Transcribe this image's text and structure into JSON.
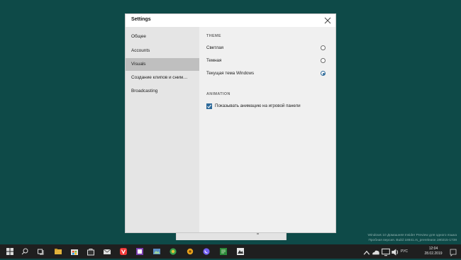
{
  "dialog": {
    "title": "Settings"
  },
  "sidebar": {
    "items": [
      {
        "label": "Общее",
        "active": false
      },
      {
        "label": "Accounts",
        "active": false
      },
      {
        "label": "Visuals",
        "active": true
      },
      {
        "label": "Создание клипов и сним…",
        "active": false
      },
      {
        "label": "Broadcasting",
        "active": false
      }
    ]
  },
  "theme": {
    "heading": "THEME",
    "options": [
      {
        "label": "Светлая",
        "selected": false
      },
      {
        "label": "Темная",
        "selected": false
      },
      {
        "label": "Текущая тема Windows",
        "selected": true
      }
    ]
  },
  "animation": {
    "heading": "ANIMATION",
    "checkbox_label": "Показывать анимацию на игровой панели",
    "checked": true
  },
  "watermark": {
    "line1": "Windows 10 Домашняя Insider Preview для одного языка",
    "line2": "Пробная версия. Build 18841.rs_prerelease.190215-1738"
  },
  "tray": {
    "language": "РУС",
    "time": "12:04",
    "date": "28.02.2019"
  },
  "colors": {
    "desktop": "#0e4a48",
    "accent": "#2e6a9a",
    "taskbar": "#1f1f1f"
  },
  "taskbar_icons": [
    "windows-start-icon",
    "search-icon",
    "task-view-icon",
    "explorer-icon",
    "store-icon",
    "mail-icon",
    "vivaldi-icon",
    "onenote-icon",
    "photos-icon",
    "paint-icon",
    "skype-icon",
    "settings-icon",
    "viber-icon",
    "notepad-icon",
    "xbox-icon",
    "onedrive-icon"
  ]
}
